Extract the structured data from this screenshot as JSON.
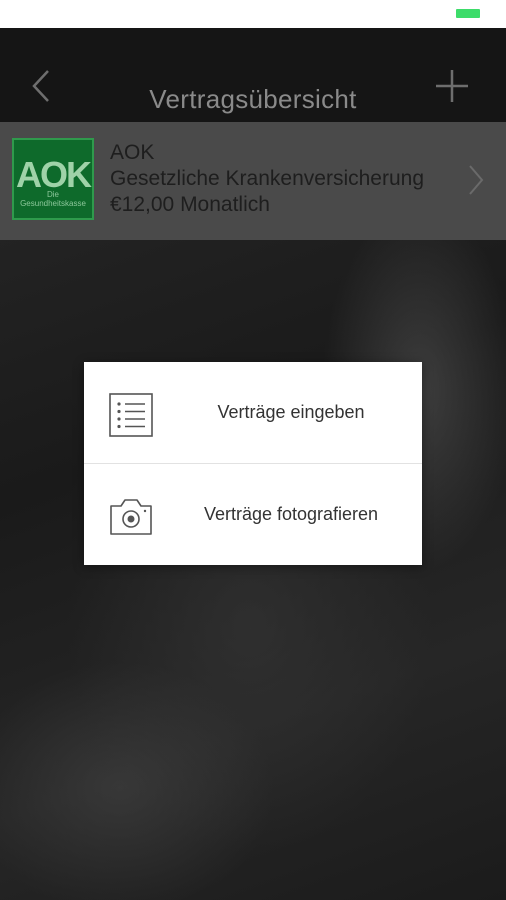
{
  "navbar": {
    "title": "Vertragsübersicht",
    "back_icon": "chevron-left-icon",
    "add_icon": "plus-icon"
  },
  "contract": {
    "logo_text": "AOK",
    "logo_subtext": "Die Gesundheitskasse",
    "provider": "AOK",
    "category": "Gesetzliche Krankenversicherung",
    "price": "€12,00 Monatlich"
  },
  "dialog": {
    "items": [
      {
        "label": "Verträge eingeben",
        "icon": "list-icon"
      },
      {
        "label": "Verträge fotografieren",
        "icon": "camera-icon"
      }
    ]
  },
  "colors": {
    "navbar_bg": "#151515",
    "row_bg": "#4a4a4a",
    "logo_green": "#0e6a2b",
    "battery": "#3ddc6a"
  }
}
